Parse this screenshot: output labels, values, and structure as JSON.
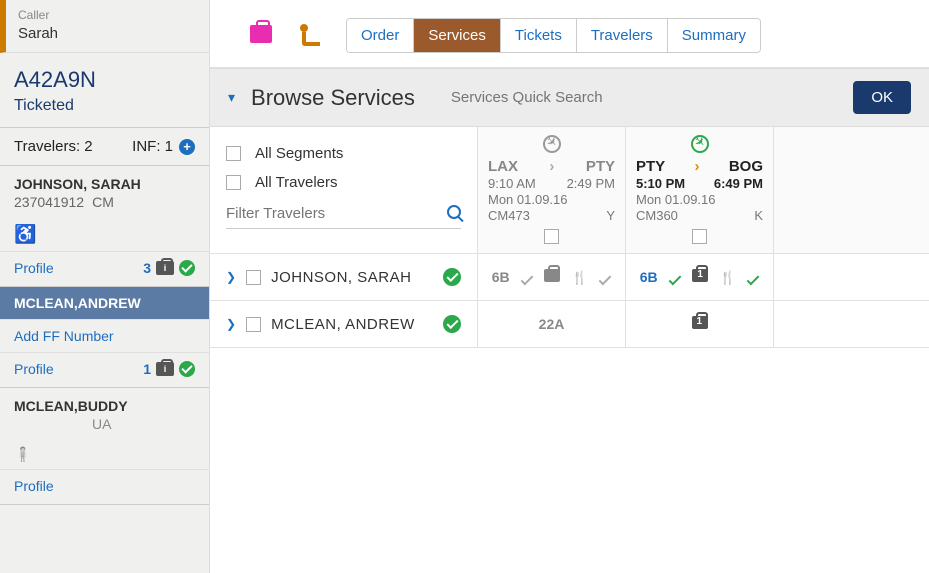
{
  "caller": {
    "label": "Caller",
    "name": "Sarah"
  },
  "pnr": {
    "code": "A42A9N",
    "status": "Ticketed"
  },
  "travelers_summary": {
    "label": "Travelers: 2",
    "inf": "INF: 1"
  },
  "sidebar_travelers": [
    {
      "name": "JOHNSON, SARAH",
      "sub1": "237041912",
      "sub2": "CM",
      "wheelchair": true,
      "profile_link": "Profile",
      "count": "3"
    },
    {
      "name": "MCLEAN,ANDREW",
      "active": true,
      "add_ff": "Add FF Number",
      "profile_link": "Profile",
      "count": "1"
    },
    {
      "name": "MCLEAN,BUDDY",
      "sub2": "UA",
      "infant": true,
      "profile_link": "Profile"
    }
  ],
  "tabs": [
    "Order",
    "Services",
    "Tickets",
    "Travelers",
    "Summary"
  ],
  "active_tab": "Services",
  "browse": {
    "title": "Browse Services",
    "search_placeholder": "Services Quick Search",
    "ok": "OK"
  },
  "filters": {
    "all_segments": "All Segments",
    "all_travelers": "All Travelers",
    "filter_placeholder": "Filter Travelers"
  },
  "segments": [
    {
      "from": "LAX",
      "to": "PTY",
      "dep": "9:10 AM",
      "arr": "2:49 PM",
      "date": "Mon 01.09.16",
      "flight": "CM473",
      "class": "Y",
      "active": false
    },
    {
      "from": "PTY",
      "to": "BOG",
      "dep": "5:10 PM",
      "arr": "6:49 PM",
      "date": "Mon 01.09.16",
      "flight": "CM360",
      "class": "K",
      "active": true
    }
  ],
  "traveler_rows": [
    {
      "name": "JOHNSON,  SARAH",
      "seats": [
        "6B",
        "6B"
      ],
      "seg1": {
        "seat_ok": true,
        "bag": true,
        "meal": true,
        "meal_ok": true
      },
      "seg2": {
        "seat_ok": true,
        "bag": true,
        "bag_num": true,
        "meal": true,
        "meal_ok": true,
        "active": true
      }
    },
    {
      "name": "MCLEAN,  ANDREW",
      "seats": [
        "22A",
        ""
      ],
      "seg1": {},
      "seg2": {
        "bag": true,
        "bag_num": true
      }
    }
  ]
}
